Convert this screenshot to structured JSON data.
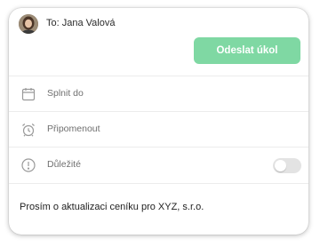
{
  "recipient": {
    "to_label": "To: Jana Valová"
  },
  "actions": {
    "send_label": "Odeslat úkol",
    "send_color": "#7fd8a3"
  },
  "fields": [
    {
      "label": "Splnit do",
      "icon": "calendar-icon"
    },
    {
      "label": "Připomenout",
      "icon": "alarm-clock-icon"
    },
    {
      "label": "Důležité",
      "icon": "exclamation-circle-icon",
      "toggle_on": false
    }
  ],
  "message": {
    "text": "Prosím o aktualizaci ceníku pro XYZ, s.r.o."
  }
}
